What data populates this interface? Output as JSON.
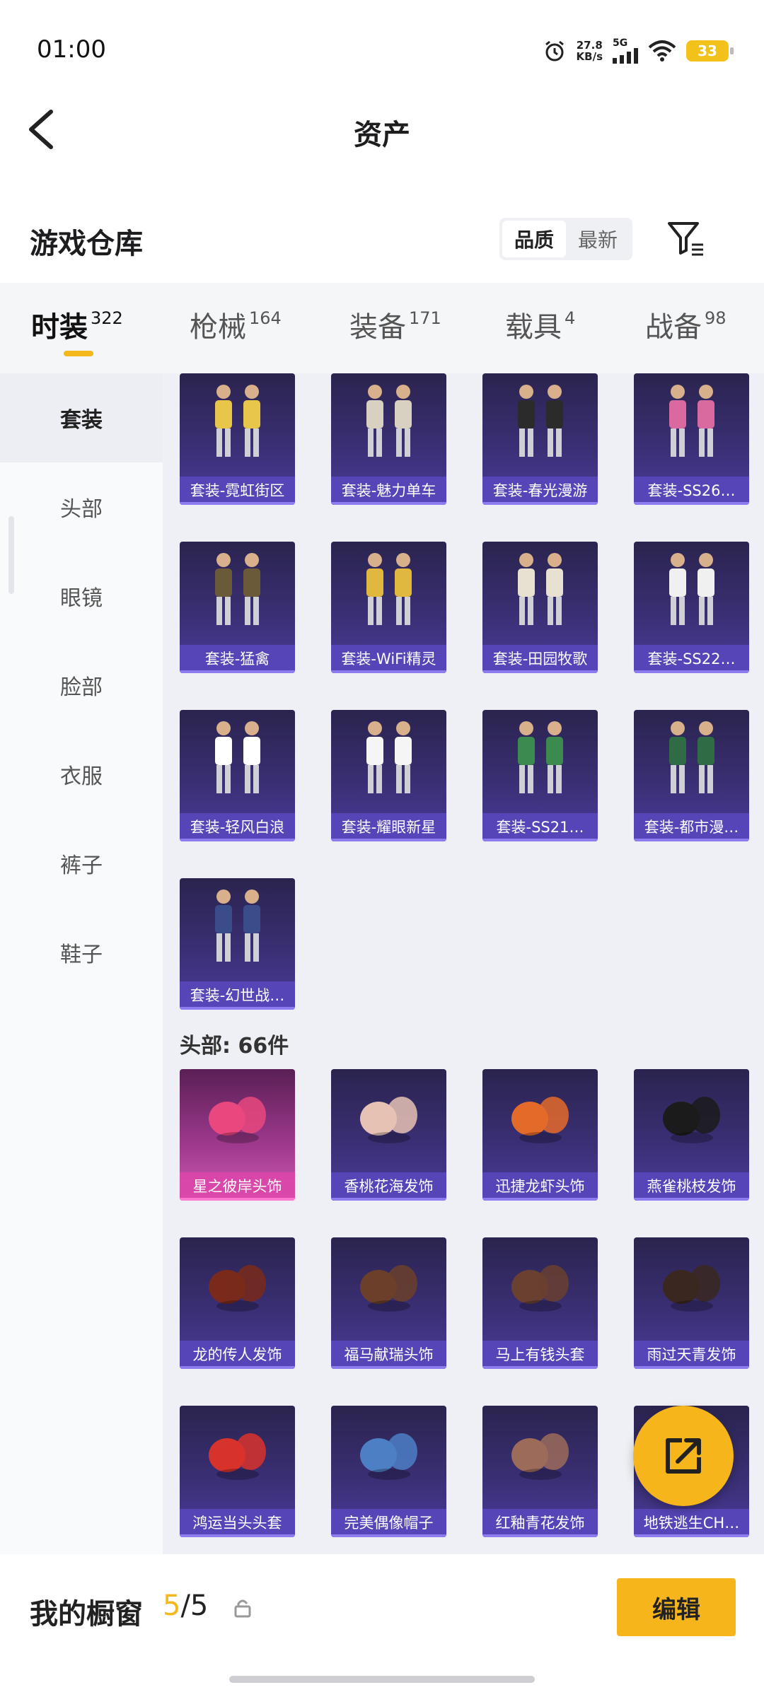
{
  "status_bar": {
    "time": "01:00",
    "speed_value": "27.8",
    "speed_unit": "KB/s",
    "network": "5G",
    "battery": "33"
  },
  "header": {
    "title": "资产"
  },
  "warehouse": {
    "title": "游戏仓库",
    "sort_options": [
      "品质",
      "最新"
    ],
    "active_sort": "品质"
  },
  "tabs": [
    {
      "label": "时装",
      "count": "322",
      "active": true
    },
    {
      "label": "枪械",
      "count": "164",
      "active": false
    },
    {
      "label": "装备",
      "count": "171",
      "active": false
    },
    {
      "label": "载具",
      "count": "4",
      "active": false
    },
    {
      "label": "战备",
      "count": "98",
      "active": false
    }
  ],
  "sidebar": {
    "items": [
      {
        "label": "套装",
        "active": true
      },
      {
        "label": "头部",
        "active": false
      },
      {
        "label": "眼镜",
        "active": false
      },
      {
        "label": "脸部",
        "active": false
      },
      {
        "label": "衣服",
        "active": false
      },
      {
        "label": "裤子",
        "active": false
      },
      {
        "label": "鞋子",
        "active": false
      }
    ]
  },
  "suits": [
    {
      "label": "套装-霓虹街区",
      "icon": "outfit-icon"
    },
    {
      "label": "套装-魅力单车",
      "icon": "outfit-icon"
    },
    {
      "label": "套装-春光漫游",
      "icon": "outfit-icon"
    },
    {
      "label": "套装-SS26…",
      "icon": "outfit-icon"
    },
    {
      "label": "套装-猛禽",
      "icon": "outfit-icon"
    },
    {
      "label": "套装-WiFi精灵",
      "icon": "outfit-icon"
    },
    {
      "label": "套装-田园牧歌",
      "icon": "outfit-icon"
    },
    {
      "label": "套装-SS22…",
      "icon": "outfit-icon"
    },
    {
      "label": "套装-轻风白浪",
      "icon": "outfit-icon"
    },
    {
      "label": "套装-耀眼新星",
      "icon": "outfit-icon"
    },
    {
      "label": "套装-SS21…",
      "icon": "outfit-icon"
    },
    {
      "label": "套装-都市漫…",
      "icon": "outfit-icon"
    },
    {
      "label": "套装-幻世战…",
      "icon": "outfit-icon"
    }
  ],
  "head_section": {
    "title": "头部: 66件"
  },
  "head_items": [
    {
      "label": "星之彼岸头饰",
      "rarity": "legendary"
    },
    {
      "label": "香桃花海发饰",
      "rarity": "epic"
    },
    {
      "label": "迅捷龙虾头饰",
      "rarity": "epic"
    },
    {
      "label": "燕雀桃枝发饰",
      "rarity": "epic"
    },
    {
      "label": "龙的传人发饰",
      "rarity": "epic"
    },
    {
      "label": "福马献瑞头饰",
      "rarity": "epic"
    },
    {
      "label": "马上有钱头套",
      "rarity": "epic"
    },
    {
      "label": "雨过天青发饰",
      "rarity": "epic"
    },
    {
      "label": "鸿运当头头套",
      "rarity": "epic"
    },
    {
      "label": "完美偶像帽子",
      "rarity": "epic"
    },
    {
      "label": "红釉青花发饰",
      "rarity": "epic"
    },
    {
      "label": "地铁逃生CH…",
      "rarity": "epic"
    }
  ],
  "colors": {
    "accent": "#f6b51a",
    "card_epic": "#3a2f74",
    "card_legendary": "#a13a8f"
  },
  "bottom": {
    "showcase_label": "我的橱窗",
    "showcase_current": "5",
    "showcase_total": "/5",
    "edit_label": "编辑"
  }
}
